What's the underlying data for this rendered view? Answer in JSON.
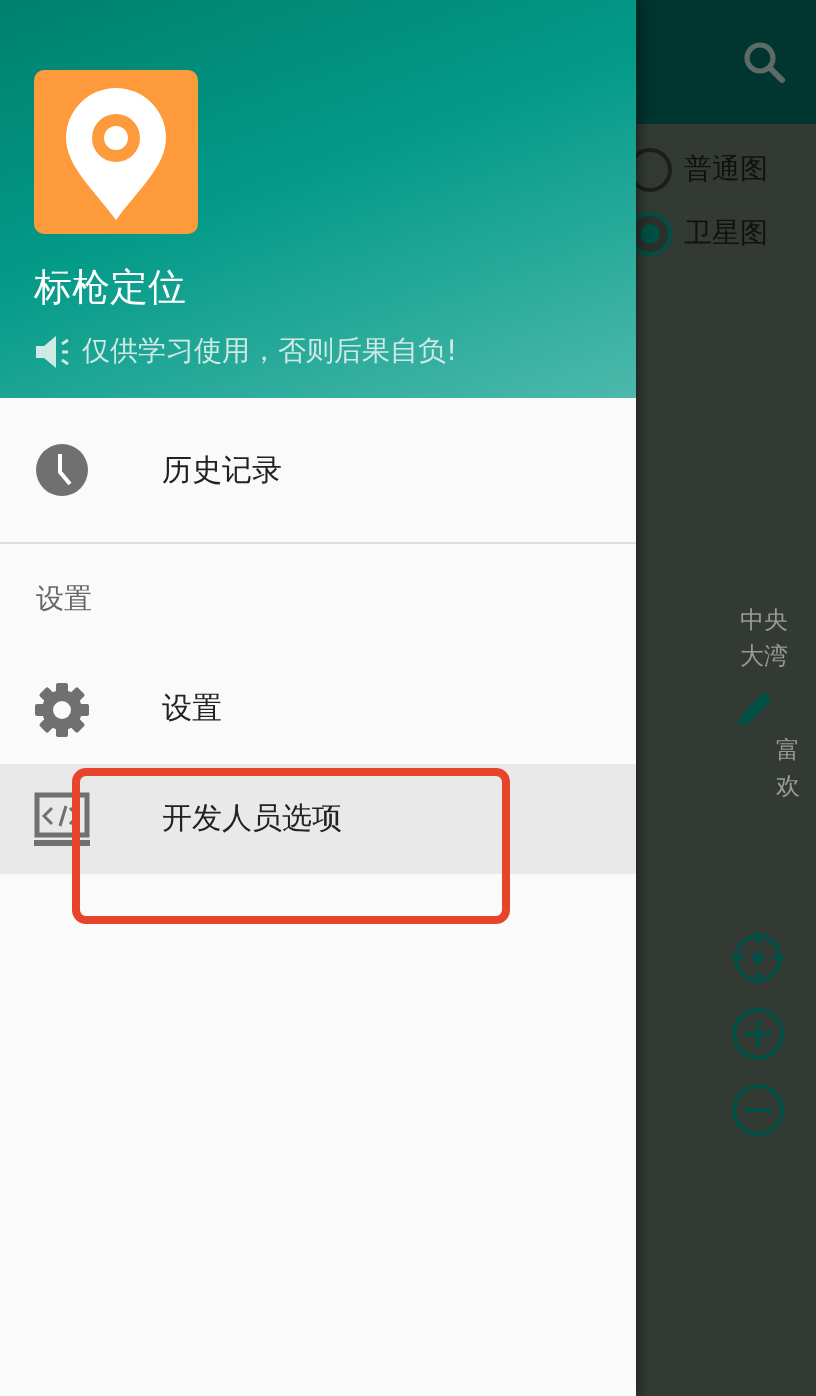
{
  "map": {
    "map_types": [
      {
        "label": "普通图",
        "selected": false
      },
      {
        "label": "卫星图",
        "selected": true
      }
    ],
    "labels": [
      "中央",
      "大湾",
      "富",
      "欢"
    ]
  },
  "drawer": {
    "app_name": "标枪定位",
    "notice": "仅供学习使用，否则后果自负!",
    "items": [
      {
        "kind": "item",
        "label": "历史记录",
        "selected": false
      },
      {
        "kind": "divider"
      },
      {
        "kind": "header",
        "label": "设置"
      },
      {
        "kind": "item",
        "label": "设置",
        "selected": false
      },
      {
        "kind": "item",
        "label": "开发人员选项",
        "selected": true
      }
    ]
  }
}
